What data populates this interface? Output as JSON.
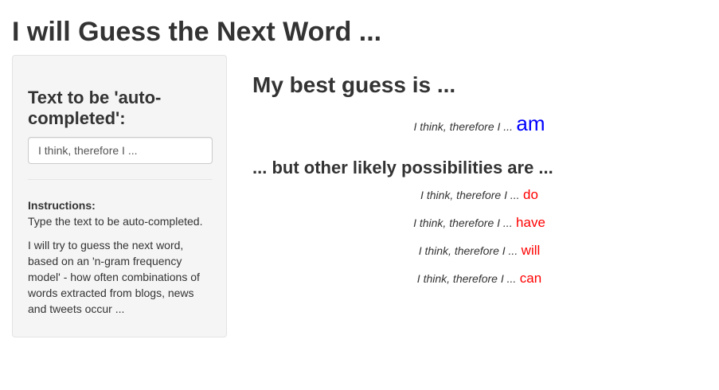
{
  "page": {
    "title": "I will Guess the Next Word ..."
  },
  "sidebar": {
    "input_label": "Text to be 'auto-completed':",
    "input_value": "I think, therefore I ...",
    "instructions_heading": "Instructions:",
    "instructions_line": "Type the text to be auto-completed.",
    "instructions_paragraph": "I will try to guess the next word, based on an 'n-gram frequency model' - how often combinations of words extracted from blogs, news and tweets occur ..."
  },
  "main": {
    "best_heading": "My best guess is ...",
    "best_guess": {
      "prefix": "I think, therefore I ...",
      "word": "am"
    },
    "others_heading": "... but other likely possibilities are ...",
    "alternatives": [
      {
        "prefix": "I think, therefore I ...",
        "word": "do"
      },
      {
        "prefix": "I think, therefore I ...",
        "word": "have"
      },
      {
        "prefix": "I think, therefore I ...",
        "word": "will"
      },
      {
        "prefix": "I think, therefore I ...",
        "word": "can"
      }
    ]
  },
  "colors": {
    "best_word": "#0000ff",
    "alternative_word": "#ff0000",
    "text": "#333333",
    "sidebar_background": "#f5f5f5"
  }
}
